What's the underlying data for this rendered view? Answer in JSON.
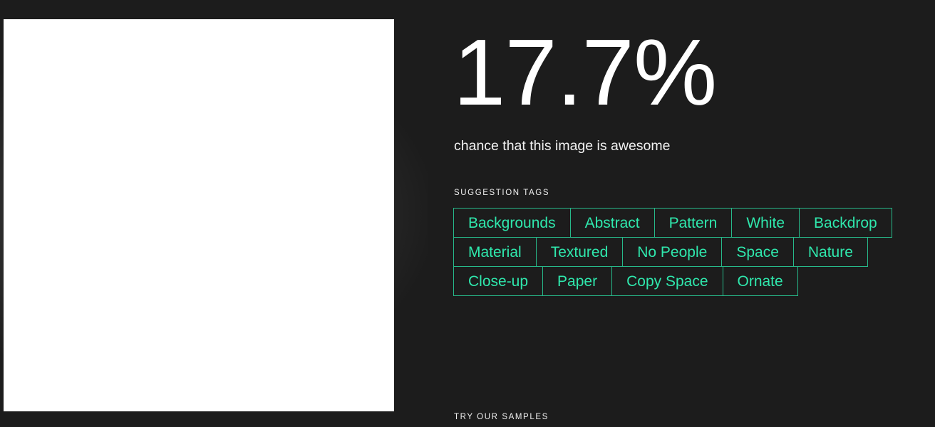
{
  "theme": {
    "background": "#1c1c1c",
    "accent": "#2fe8ad",
    "accent_border": "#27b98a",
    "text": "#ffffff"
  },
  "preview": {
    "alt": "uploaded image preview",
    "state": "blank-white-image"
  },
  "score": {
    "value": "17.7%",
    "caption": "chance that this image is awesome"
  },
  "tags_section": {
    "label": "SUGGESTION TAGS",
    "tags": [
      "Backgrounds",
      "Abstract",
      "Pattern",
      "White",
      "Backdrop",
      "Material",
      "Textured",
      "No People",
      "Space",
      "Nature",
      "Close-up",
      "Paper",
      "Copy Space",
      "Ornate"
    ]
  },
  "samples_section": {
    "label": "TRY OUR SAMPLES"
  }
}
